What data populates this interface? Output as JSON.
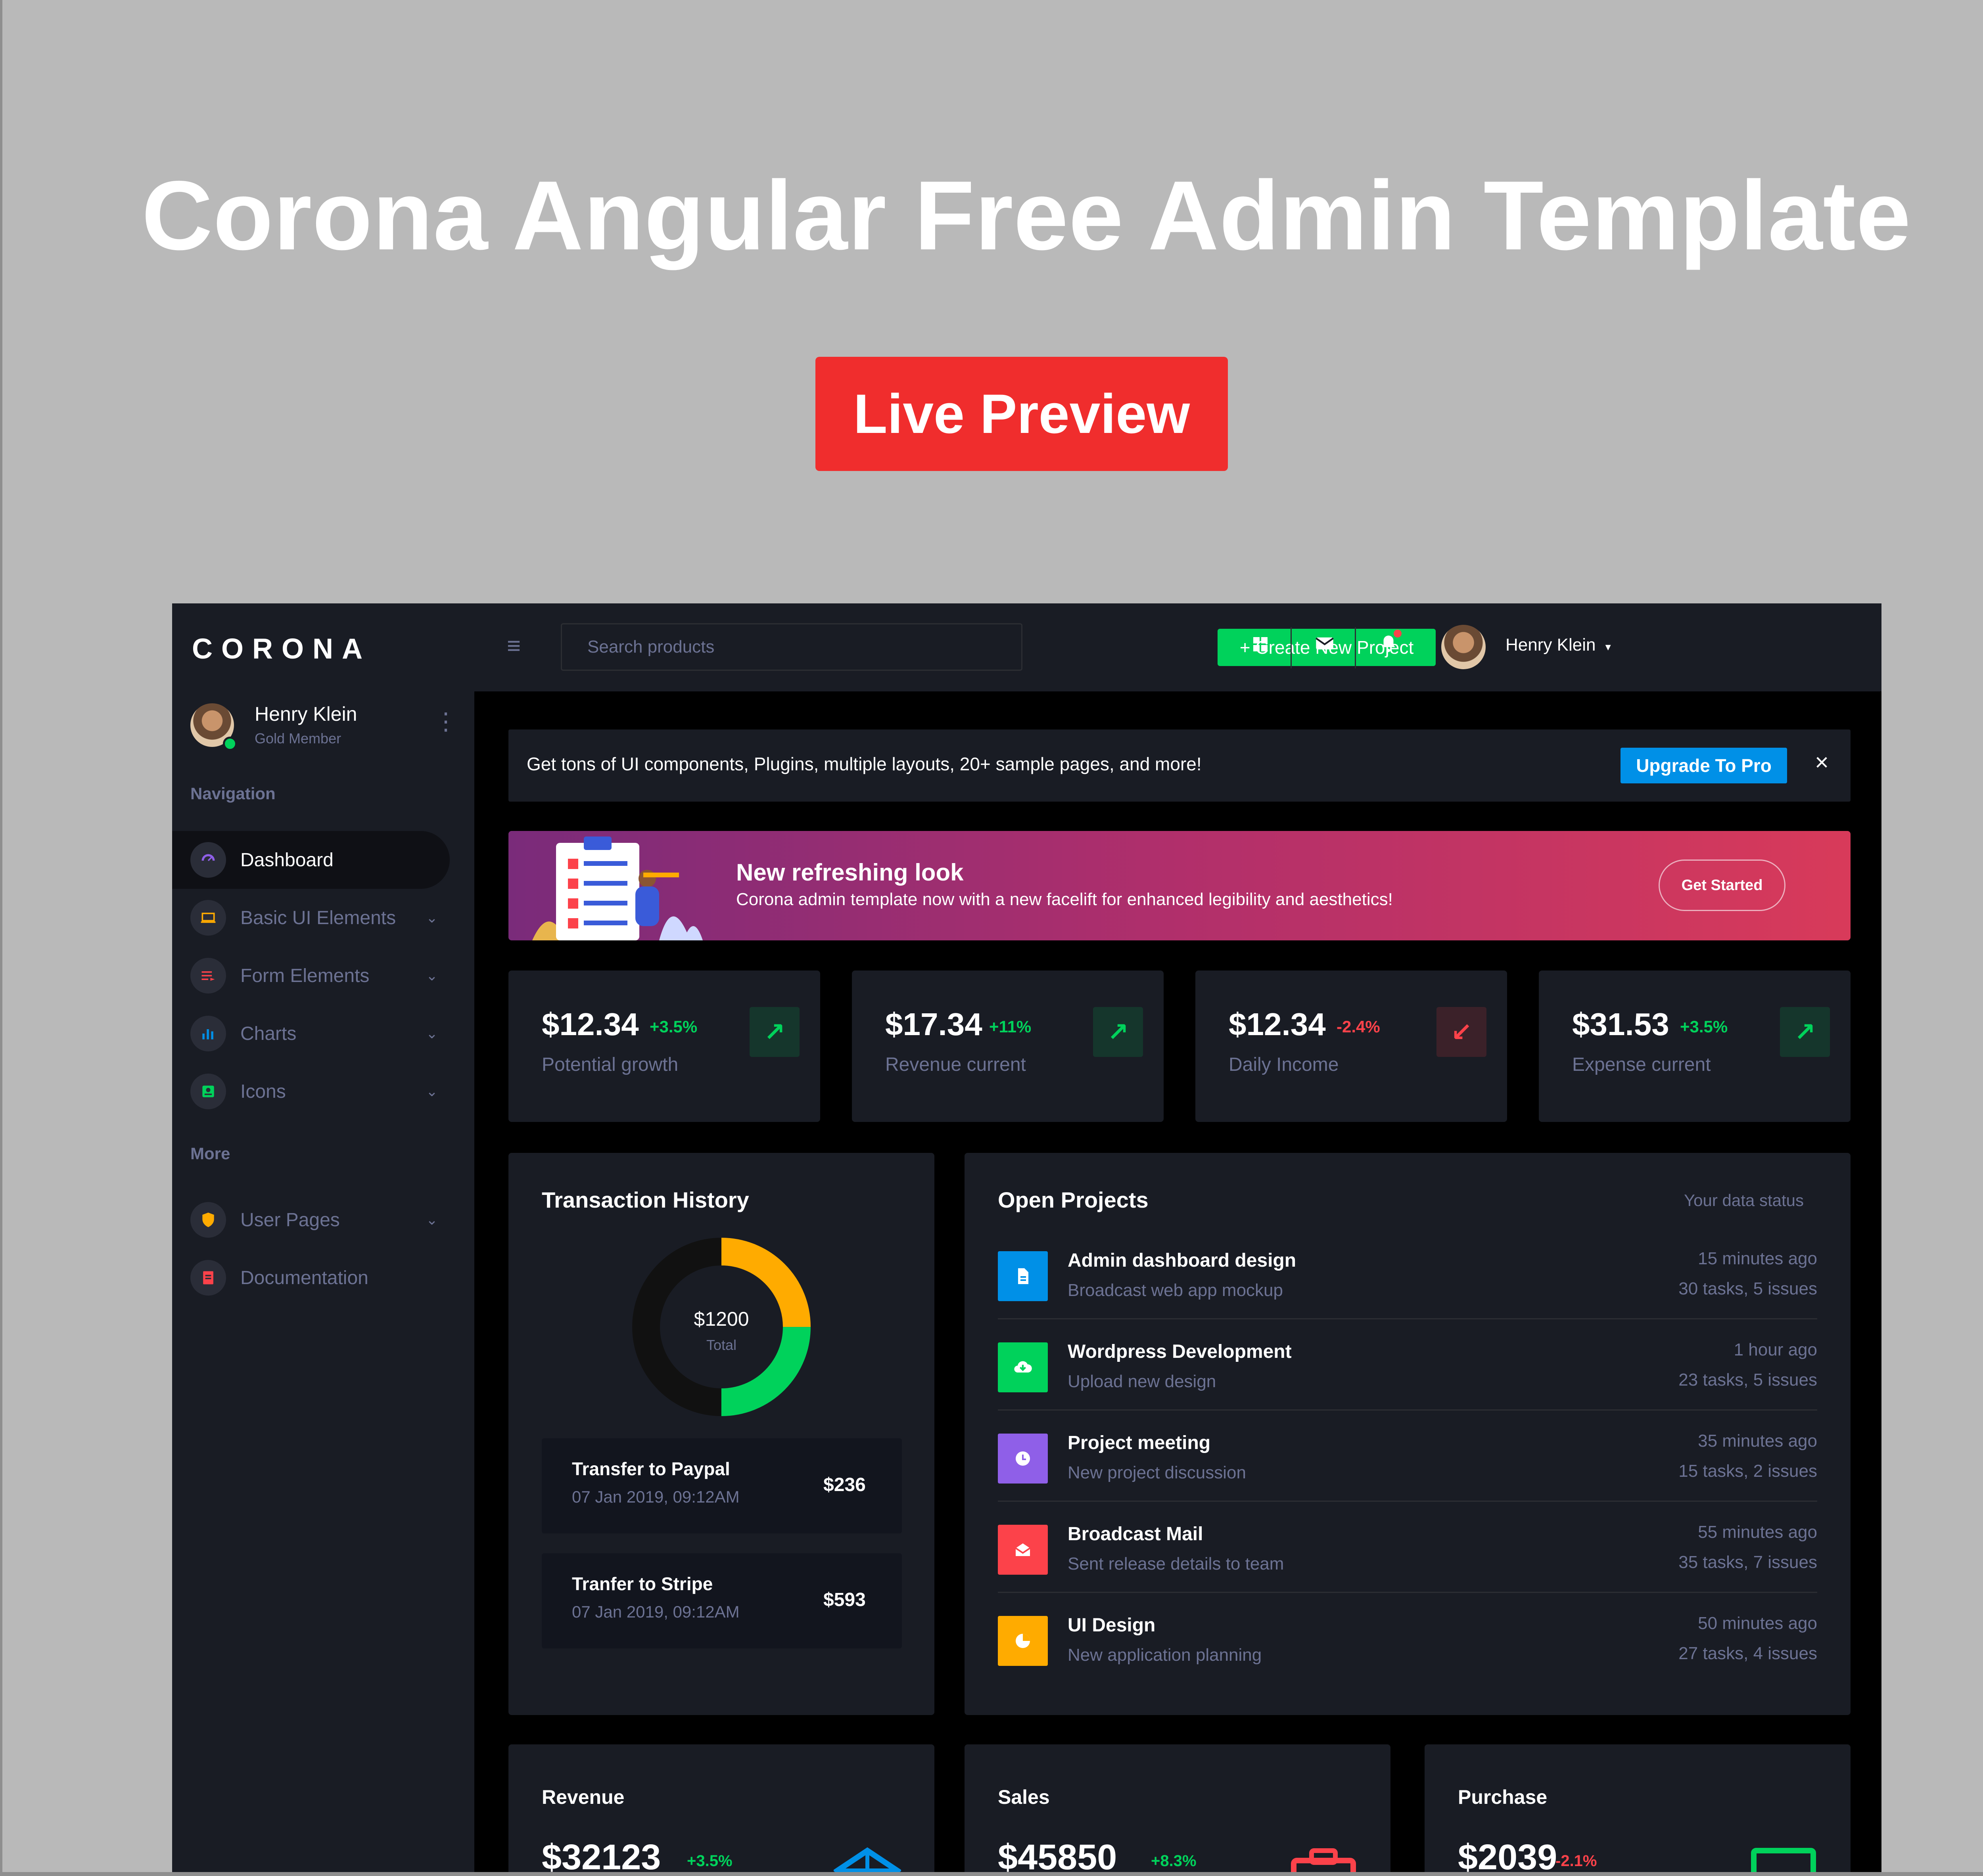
{
  "hero": {
    "title": "Corona Angular Free Admin Template",
    "cta": "Live Preview"
  },
  "colors": {
    "page_bg": "#b9b9b9",
    "cta_red": "#f02d2d",
    "panel": "#191c24",
    "success": "#00d25b",
    "danger": "#fc424a",
    "primary": "#0090e7",
    "warning": "#ffab00",
    "muted": "#6c7293"
  },
  "app": {
    "brand": "CORONA",
    "sidebar": {
      "user_name": "Henry Klein",
      "user_role": "Gold Member",
      "nav_heading": "Navigation",
      "items": [
        {
          "label": "Dashboard",
          "icon": "speedometer-icon",
          "active": true
        },
        {
          "label": "Basic UI Elements",
          "icon": "laptop-icon"
        },
        {
          "label": "Form Elements",
          "icon": "playlist-icon"
        },
        {
          "label": "Charts",
          "icon": "chart-bar-icon"
        },
        {
          "label": "Icons",
          "icon": "contacts-icon"
        }
      ],
      "more_heading": "More",
      "more_items": [
        {
          "label": "User Pages",
          "icon": "security-icon"
        },
        {
          "label": "Documentation",
          "icon": "file-document-icon"
        }
      ]
    },
    "topbar": {
      "search_placeholder": "Search products",
      "create_label": "+ Create New Project",
      "user_name": "Henry Klein"
    },
    "promo": {
      "text": "Get tons of UI components, Plugins, multiple layouts, 20+ sample pages, and more!",
      "upgrade_label": "Upgrade To Pro",
      "close": "×"
    },
    "banner": {
      "title": "New refreshing look",
      "subtitle": "Corona admin template now with a new facelift for enhanced legibility and aesthetics!",
      "cta": "Get Started"
    },
    "stats": [
      {
        "value": "$12.34",
        "change": "+3.5%",
        "label": "Potential growth",
        "trend": "up"
      },
      {
        "value": "$17.34",
        "change": "+11%",
        "label": "Revenue current",
        "trend": "up"
      },
      {
        "value": "$12.34",
        "change": "-2.4%",
        "label": "Daily Income",
        "trend": "down"
      },
      {
        "value": "$31.53",
        "change": "+3.5%",
        "label": "Expense current",
        "trend": "up"
      }
    ],
    "transactions": {
      "title": "Transaction History",
      "total_value": "$1200",
      "total_label": "Total",
      "donut_segments": [
        {
          "color": "#ffab00",
          "fraction": 0.25
        },
        {
          "color": "#00d25b",
          "fraction": 0.25
        },
        {
          "color": "#111111",
          "fraction": 0.5
        }
      ],
      "rows": [
        {
          "name": "Transfer to Paypal",
          "date": "07 Jan 2019, 09:12AM",
          "amount": "$236"
        },
        {
          "name": "Tranfer to Stripe",
          "date": "07 Jan 2019, 09:12AM",
          "amount": "$593"
        }
      ]
    },
    "projects": {
      "title": "Open Projects",
      "status_label": "Your data status",
      "items": [
        {
          "title": "Admin dashboard design",
          "subtitle": "Broadcast web app mockup",
          "time": "15 minutes ago",
          "tasks": "30 tasks, 5 issues",
          "icon": "file-document-icon",
          "color": "#0090e7"
        },
        {
          "title": "Wordpress Development",
          "subtitle": "Upload new design",
          "time": "1 hour ago",
          "tasks": "23 tasks, 5 issues",
          "icon": "cloud-download-icon",
          "color": "#00d25b"
        },
        {
          "title": "Project meeting",
          "subtitle": "New project discussion",
          "time": "35 minutes ago",
          "tasks": "15 tasks, 2 issues",
          "icon": "clock-icon",
          "color": "#8f5fe8"
        },
        {
          "title": "Broadcast Mail",
          "subtitle": "Sent release details to team",
          "time": "55 minutes ago",
          "tasks": "35 tasks, 7 issues",
          "icon": "email-open-icon",
          "color": "#fc424a"
        },
        {
          "title": "UI Design",
          "subtitle": "New application planning",
          "time": "50 minutes ago",
          "tasks": "27 tasks, 4 issues",
          "icon": "chart-pie-icon",
          "color": "#ffab00"
        }
      ]
    },
    "mini_cards": [
      {
        "title": "Revenue",
        "value": "$32123",
        "change": "+3.5%",
        "trend": "up",
        "icon": "codepen-icon",
        "color": "#0090e7"
      },
      {
        "title": "Sales",
        "value": "$45850",
        "change": "+8.3%",
        "trend": "up",
        "icon": "wallet-travel-icon",
        "color": "#fc424a"
      },
      {
        "title": "Purchase",
        "value": "$2039",
        "change": "-2.1%",
        "trend": "down",
        "icon": "monitor-icon",
        "color": "#00d25b"
      }
    ]
  }
}
